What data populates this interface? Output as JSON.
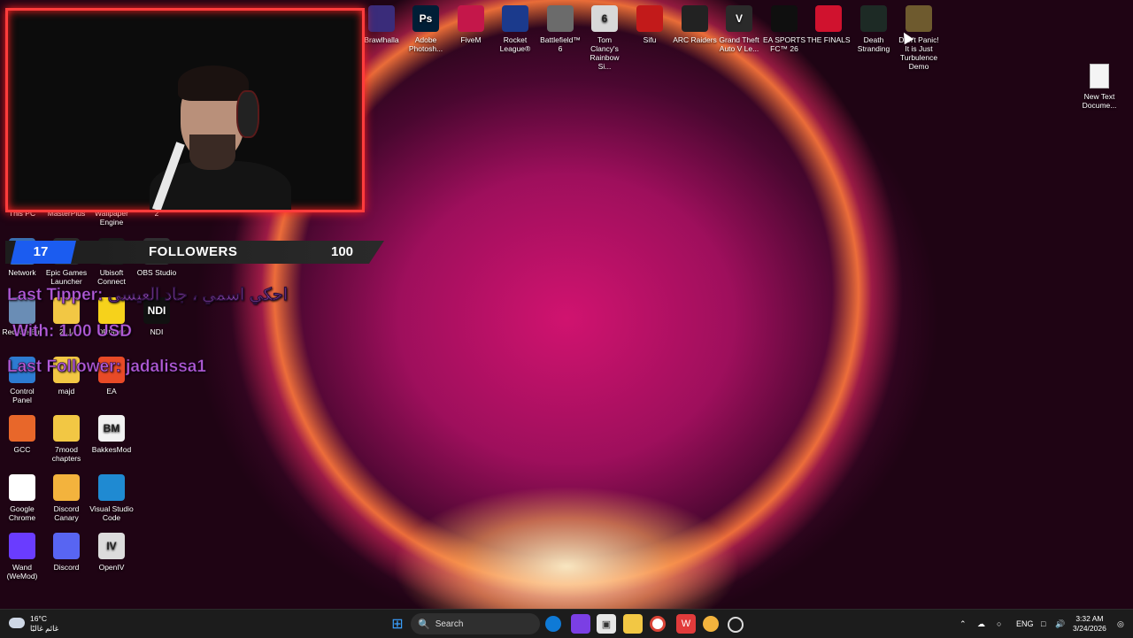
{
  "webcam": {},
  "desktop_icons_top": [
    {
      "label": "Brawlhalla",
      "color": "#3a2c7a",
      "glyph": ""
    },
    {
      "label": "Adobe Photosh...",
      "color": "#001e36",
      "glyph": "Ps"
    },
    {
      "label": "FiveM",
      "color": "#c4174a",
      "glyph": ""
    },
    {
      "label": "Rocket League®",
      "color": "#1b3a8c",
      "glyph": ""
    },
    {
      "label": "Battlefield™ 6",
      "color": "#6b6b6b",
      "glyph": ""
    },
    {
      "label": "Tom Clancy's Rainbow Si...",
      "color": "#d8d8d8",
      "glyph": "6"
    },
    {
      "label": "Sifu",
      "color": "#c21a1a",
      "glyph": ""
    },
    {
      "label": "ARC Raiders",
      "color": "#222222",
      "glyph": ""
    },
    {
      "label": "Grand Theft Auto V Le...",
      "color": "#2a2a2a",
      "glyph": "V"
    },
    {
      "label": "EA SPORTS FC™ 26",
      "color": "#0f0f0f",
      "glyph": ""
    },
    {
      "label": "THE FINALS",
      "color": "#d0122e",
      "glyph": ""
    },
    {
      "label": "Death Stranding",
      "color": "#1d2a25",
      "glyph": ""
    },
    {
      "label": "Don't Panic! It is Just Turbulence Demo",
      "color": "#6e5a2e",
      "glyph": ""
    }
  ],
  "desktop_icons_left": [
    {
      "label": "This PC",
      "color": "#3a6fb0",
      "glyph": ""
    },
    {
      "label": "MasterPlus",
      "color": "#222",
      "glyph": ""
    },
    {
      "label": "Wallpaper Engine",
      "color": "#1e4e8c",
      "glyph": ""
    },
    {
      "label": "2",
      "color": "#e5b94a",
      "glyph": ""
    },
    {
      "label": "Network",
      "color": "#3a6fb0",
      "glyph": ""
    },
    {
      "label": "Epic Games Launcher",
      "color": "#2a2a2a",
      "glyph": ""
    },
    {
      "label": "Ubisoft Connect",
      "color": "#1a1a1a",
      "glyph": ""
    },
    {
      "label": "OBS Studio",
      "color": "#302e31",
      "glyph": ""
    },
    {
      "label": "Recycle Bin",
      "color": "#6a8db5",
      "glyph": ""
    },
    {
      "label": "بل 2",
      "color": "#f2c744",
      "glyph": ""
    },
    {
      "label": "DRtaser",
      "color": "#f6d21b",
      "glyph": ""
    },
    {
      "label": "NDI",
      "color": "#111",
      "glyph": "NDI"
    },
    {
      "label": "Control Panel",
      "color": "#2d7bd1",
      "glyph": ""
    },
    {
      "label": "majd",
      "color": "#f2c744",
      "glyph": ""
    },
    {
      "label": "EA",
      "color": "#e84a27",
      "glyph": ""
    },
    {
      "label": "GCC",
      "color": "#e8672a",
      "glyph": ""
    },
    {
      "label": "7mood chapters",
      "color": "#f2c744",
      "glyph": ""
    },
    {
      "label": "BakkesMod",
      "color": "#f2f2f2",
      "glyph": "BM"
    },
    {
      "label": "Google Chrome",
      "color": "#ffffff",
      "glyph": ""
    },
    {
      "label": "Discord Canary",
      "color": "#f3b33d",
      "glyph": ""
    },
    {
      "label": "Visual Studio Code",
      "color": "#1f8ad2",
      "glyph": ""
    },
    {
      "label": "Wand (WeMod)",
      "color": "#6a3cff",
      "glyph": ""
    },
    {
      "label": "Discord",
      "color": "#5865f2",
      "glyph": ""
    },
    {
      "label": "OpenIV",
      "color": "#dcdcdc",
      "glyph": "IV"
    }
  ],
  "new_text_doc": {
    "label": "New Text Docume..."
  },
  "followers_widget": {
    "current": "17",
    "label": "FOLLOWERS",
    "goal": "100"
  },
  "overlay": {
    "last_tipper": "Last Tipper: احكي اسمي ، جاد العيسى",
    "tip_amount": "With: 1.00 USD",
    "last_follower": "Last Follower: jadalissa1"
  },
  "taskbar": {
    "weather_temp": "16°C",
    "weather_desc": "غائم غالبًا",
    "search_label": "Search",
    "language": "ENG",
    "time": "3:32 AM",
    "date": "3/24/2026"
  }
}
